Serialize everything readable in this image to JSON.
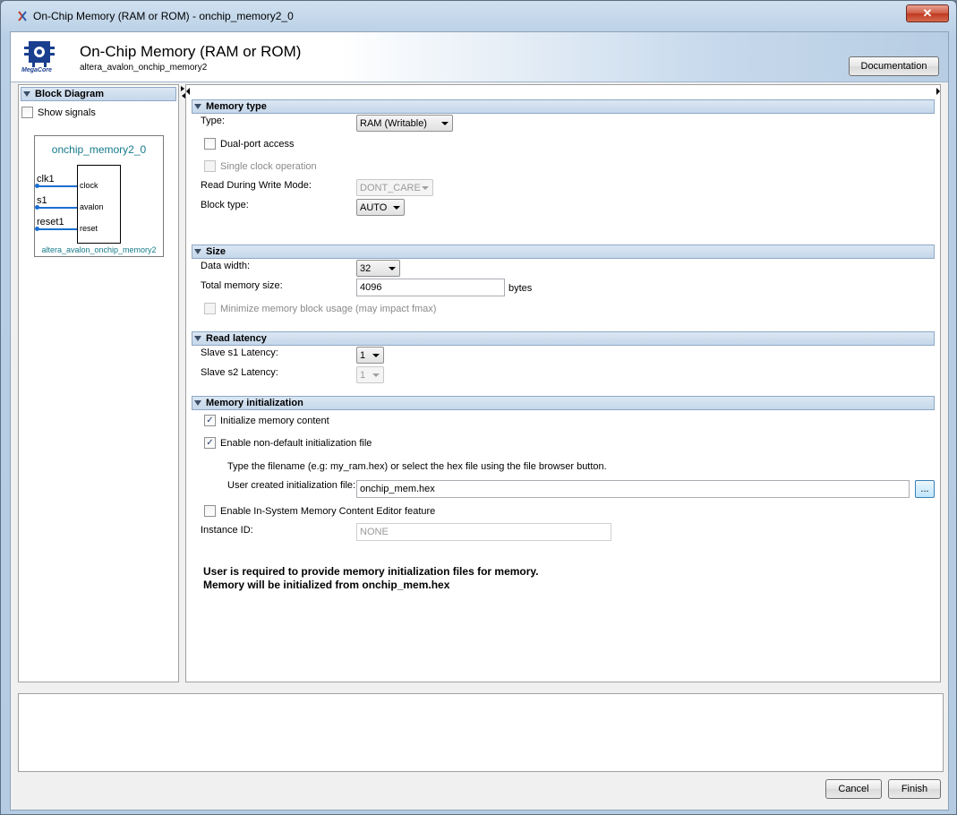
{
  "window": {
    "title": "On-Chip Memory (RAM or ROM) - onchip_memory2_0",
    "close_glyph": "✕"
  },
  "header": {
    "title": "On-Chip Memory (RAM or ROM)",
    "subtitle": "altera_avalon_onchip_memory2",
    "logo_text": "MegaCore",
    "documentation_label": "Documentation"
  },
  "left_panel": {
    "section_title": "Block Diagram",
    "show_signals_label": "Show signals",
    "show_signals_checked": false,
    "diagram": {
      "instance_name": "onchip_memory2_0",
      "component_name": "altera_avalon_onchip_memory2",
      "signals": [
        {
          "signal": "clk1",
          "port": "clock"
        },
        {
          "signal": "s1",
          "port": "avalon"
        },
        {
          "signal": "reset1",
          "port": "reset"
        }
      ]
    }
  },
  "memory_type": {
    "section_title": "Memory type",
    "type_label": "Type:",
    "type_value": "RAM (Writable)",
    "dual_port_label": "Dual-port access",
    "dual_port_checked": false,
    "single_clock_label": "Single clock operation",
    "read_during_write_label": "Read During Write Mode:",
    "read_during_write_value": "DONT_CARE",
    "block_type_label": "Block type:",
    "block_type_value": "AUTO"
  },
  "size": {
    "section_title": "Size",
    "data_width_label": "Data width:",
    "data_width_value": "32",
    "total_memory_label": "Total memory size:",
    "total_memory_value": "4096",
    "total_memory_unit": "bytes",
    "minimize_label": "Minimize memory block usage (may impact fmax)"
  },
  "read_latency": {
    "section_title": "Read latency",
    "s1_label": "Slave s1 Latency:",
    "s1_value": "1",
    "s2_label": "Slave s2 Latency:",
    "s2_value": "1"
  },
  "memory_init": {
    "section_title": "Memory initialization",
    "init_content_label": "Initialize memory content",
    "init_content_checked": true,
    "non_default_label": "Enable non-default initialization file",
    "non_default_checked": true,
    "hint_text": "Type the filename (e.g: my_ram.hex) or select the hex file using the file browser button.",
    "user_file_label": "User created initialization file:",
    "user_file_value": "onchip_mem.hex",
    "browse_label": "...",
    "insystem_label": "Enable In-System Memory Content Editor feature",
    "insystem_checked": false,
    "instance_id_label": "Instance ID:",
    "instance_id_value": "NONE",
    "message_line1": "User is required to provide memory initialization files for memory.",
    "message_line2": "Memory will be initialized from onchip_mem.hex"
  },
  "footer": {
    "cancel_label": "Cancel",
    "finish_label": "Finish"
  },
  "check_glyph": "✓"
}
